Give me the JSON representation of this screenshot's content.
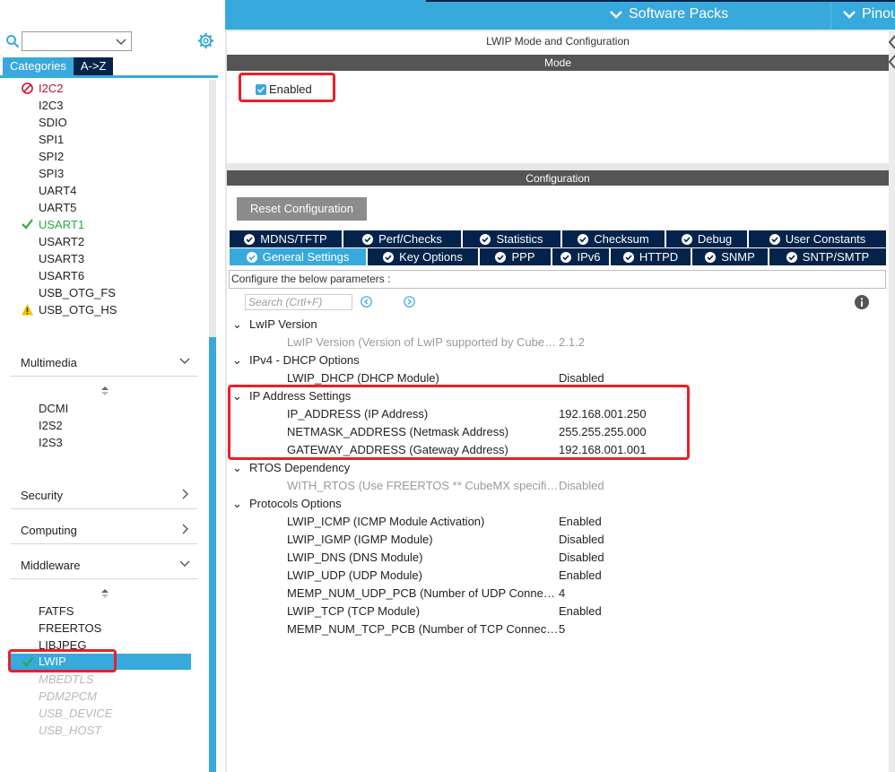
{
  "topbar": {
    "software_packs": "Software Packs",
    "pinout": "Pinou"
  },
  "sidebar": {
    "search": {
      "value": "",
      "placeholder": ""
    },
    "tabs": [
      "Categories",
      "A->Z"
    ],
    "connectivity_items": [
      {
        "label": "I2C2",
        "status": "error"
      },
      {
        "label": "I2C3",
        "status": "none"
      },
      {
        "label": "SDIO",
        "status": "none"
      },
      {
        "label": "SPI1",
        "status": "none"
      },
      {
        "label": "SPI2",
        "status": "none"
      },
      {
        "label": "SPI3",
        "status": "none"
      },
      {
        "label": "UART4",
        "status": "none"
      },
      {
        "label": "UART5",
        "status": "none"
      },
      {
        "label": "USART1",
        "status": "ok"
      },
      {
        "label": "USART2",
        "status": "none"
      },
      {
        "label": "USART3",
        "status": "none"
      },
      {
        "label": "USART6",
        "status": "none"
      },
      {
        "label": "USB_OTG_FS",
        "status": "none"
      },
      {
        "label": "USB_OTG_HS",
        "status": "warning"
      }
    ],
    "sections": {
      "multimedia": "Multimedia",
      "security": "Security",
      "computing": "Computing",
      "middleware": "Middleware"
    },
    "multimedia_items": [
      "DCMI",
      "I2S2",
      "I2S3"
    ],
    "middleware_items": [
      {
        "label": "FATFS",
        "state": "normal"
      },
      {
        "label": "FREERTOS",
        "state": "normal"
      },
      {
        "label": "LIBJPEG",
        "state": "normal"
      },
      {
        "label": "LWIP",
        "state": "selected"
      },
      {
        "label": "MBEDTLS",
        "state": "disabled"
      },
      {
        "label": "PDM2PCM",
        "state": "disabled"
      },
      {
        "label": "USB_DEVICE",
        "state": "disabled"
      },
      {
        "label": "USB_HOST",
        "state": "disabled"
      }
    ]
  },
  "main": {
    "title": "LWIP Mode and Configuration",
    "mode_header": "Mode",
    "enabled_label": "Enabled",
    "enabled_checked": true,
    "configuration_header": "Configuration",
    "reset_button": "Reset Configuration",
    "tabs_row1": [
      "MDNS/TFTP",
      "Perf/Checks",
      "Statistics",
      "Checksum",
      "Debug",
      "User Constants"
    ],
    "tabs_row2": [
      "General Settings",
      "Key Options",
      "PPP",
      "IPv6",
      "HTTPD",
      "SNMP",
      "SNTP/SMTP"
    ],
    "active_tab": "General Settings",
    "configure_text": "Configure the below parameters :",
    "param_search_placeholder": "Search (Crtl+F)",
    "tree": [
      {
        "group": "LwIP Version",
        "params": [
          {
            "name": "LwIP Version (Version of LwIP supported by Cube…",
            "value": "2.1.2",
            "greyed": true
          }
        ]
      },
      {
        "group": "IPv4 - DHCP Options",
        "params": [
          {
            "name": "LWIP_DHCP (DHCP Module)",
            "value": "Disabled",
            "greyed": false
          }
        ]
      },
      {
        "group": "IP Address Settings",
        "params": [
          {
            "name": "IP_ADDRESS (IP Address)",
            "value": "192.168.001.250",
            "greyed": false
          },
          {
            "name": "NETMASK_ADDRESS (Netmask Address)",
            "value": "255.255.255.000",
            "greyed": false
          },
          {
            "name": "GATEWAY_ADDRESS (Gateway Address)",
            "value": "192.168.001.001",
            "greyed": false
          }
        ]
      },
      {
        "group": "RTOS Dependency",
        "params": [
          {
            "name": "WITH_RTOS (Use FREERTOS ** CubeMX specifi…",
            "value": "Disabled",
            "greyed": true
          }
        ]
      },
      {
        "group": "Protocols Options",
        "params": [
          {
            "name": "LWIP_ICMP (ICMP Module Activation)",
            "value": "Enabled",
            "greyed": false
          },
          {
            "name": "LWIP_IGMP (IGMP Module)",
            "value": "Disabled",
            "greyed": false
          },
          {
            "name": "LWIP_DNS (DNS Module)",
            "value": "Disabled",
            "greyed": false
          },
          {
            "name": "LWIP_UDP (UDP Module)",
            "value": "Enabled",
            "greyed": false
          },
          {
            "name": "MEMP_NUM_UDP_PCB (Number of UDP Conne…",
            "value": "4",
            "greyed": false
          },
          {
            "name": "LWIP_TCP (TCP Module)",
            "value": "Enabled",
            "greyed": false
          },
          {
            "name": "MEMP_NUM_TCP_PCB (Number of TCP Connec…",
            "value": "5",
            "greyed": false
          }
        ]
      }
    ]
  },
  "colors": {
    "accent_blue": "#38a9dc",
    "navy": "#03234b",
    "highlight_red": "#e8202a",
    "ok_green": "#2aa845",
    "error_magenta": "#c8102e",
    "warning_yellow": "#f2c400"
  },
  "icons": [
    "search-icon",
    "chevron-down-icon",
    "gear-icon",
    "check-icon",
    "error-icon",
    "warning-icon",
    "sort-icon",
    "chevron-right-icon",
    "tick-circle-icon",
    "prev-icon",
    "next-icon",
    "info-icon"
  ]
}
